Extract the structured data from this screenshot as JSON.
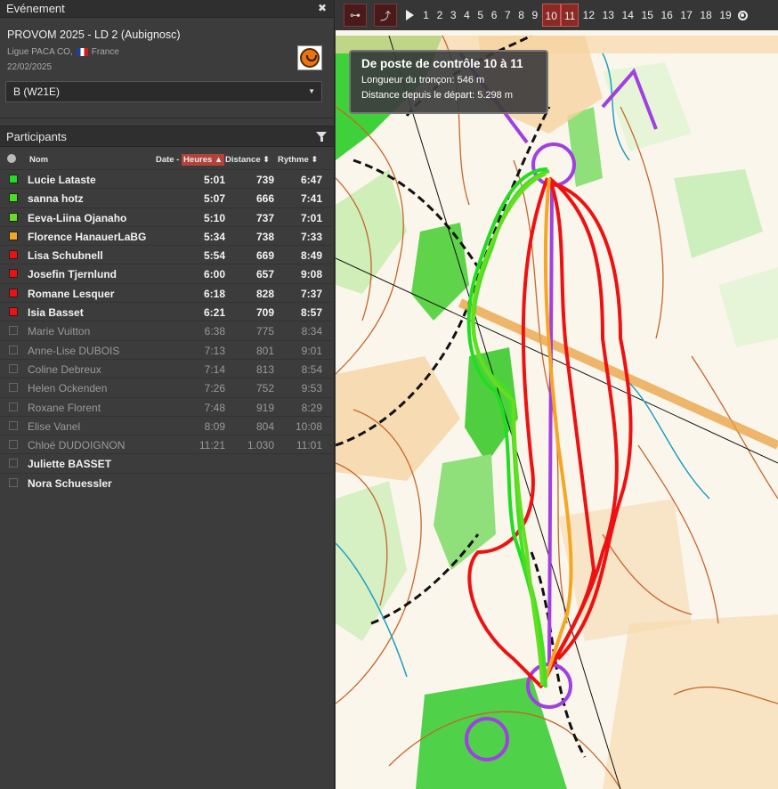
{
  "event": {
    "panel_title": "Evénement",
    "title": "PROVOM 2025 - LD 2 (Aubignosc)",
    "organizer": "Ligue PACA CO,",
    "country": "France",
    "date": "22/02/2025",
    "category": "B (W21E)"
  },
  "participants": {
    "panel_title": "Participants",
    "columns": {
      "name": "Nom",
      "time_prefix": "Date - ",
      "time": "Heures",
      "distance": "Distance",
      "pace": "Rythme"
    },
    "rows": [
      {
        "name": "Lucie Lataste",
        "time": "5:01",
        "distance": "739",
        "pace": "6:47",
        "color": "#22dd22",
        "active": true
      },
      {
        "name": "sanna hotz",
        "time": "5:07",
        "distance": "666",
        "pace": "7:41",
        "color": "#44e022",
        "active": true
      },
      {
        "name": "Eeva-Liina Ojanaho",
        "time": "5:10",
        "distance": "737",
        "pace": "7:01",
        "color": "#66dd22",
        "active": true
      },
      {
        "name": "Florence HanauerLaBG",
        "time": "5:34",
        "distance": "738",
        "pace": "7:33",
        "color": "#f5a623",
        "active": true
      },
      {
        "name": "Lisa Schubnell",
        "time": "5:54",
        "distance": "669",
        "pace": "8:49",
        "color": "#ee1111",
        "active": true
      },
      {
        "name": "Josefin Tjernlund",
        "time": "6:00",
        "distance": "657",
        "pace": "9:08",
        "color": "#ee1111",
        "active": true
      },
      {
        "name": "Romane Lesquer",
        "time": "6:18",
        "distance": "828",
        "pace": "7:37",
        "color": "#ee1111",
        "active": true
      },
      {
        "name": "Isia Basset",
        "time": "6:21",
        "distance": "709",
        "pace": "8:57",
        "color": "#ee1111",
        "active": true
      },
      {
        "name": "Marie Vuitton",
        "time": "6:38",
        "distance": "775",
        "pace": "8:34",
        "color": "",
        "active": false
      },
      {
        "name": "Anne-Lise DUBOIS",
        "time": "7:13",
        "distance": "801",
        "pace": "9:01",
        "color": "",
        "active": false
      },
      {
        "name": "Coline Debreux",
        "time": "7:14",
        "distance": "813",
        "pace": "8:54",
        "color": "",
        "active": false
      },
      {
        "name": "Helen Ockenden",
        "time": "7:26",
        "distance": "752",
        "pace": "9:53",
        "color": "",
        "active": false
      },
      {
        "name": "Roxane Florent",
        "time": "7:48",
        "distance": "919",
        "pace": "8:29",
        "color": "",
        "active": false
      },
      {
        "name": "Elise Vanel",
        "time": "8:09",
        "distance": "804",
        "pace": "10:08",
        "color": "",
        "active": false
      },
      {
        "name": "Chloé DUDOIGNON",
        "time": "11:21",
        "distance": "1.030",
        "pace": "11:01",
        "color": "",
        "active": false
      },
      {
        "name": "Juliette BASSET",
        "time": "",
        "distance": "",
        "pace": "",
        "color": "",
        "active": true
      },
      {
        "name": "Nora Schuessler",
        "time": "",
        "distance": "",
        "pace": "",
        "color": "",
        "active": true
      }
    ]
  },
  "toolbar": {
    "legs": [
      "1",
      "2",
      "3",
      "4",
      "5",
      "6",
      "7",
      "8",
      "9",
      "10",
      "11",
      "12",
      "13",
      "14",
      "15",
      "16",
      "17",
      "18",
      "19"
    ],
    "active_legs": [
      "10",
      "11"
    ],
    "icons": [
      "leg-split-icon",
      "route-icon",
      "play-icon",
      "finish-icon"
    ]
  },
  "leg_info": {
    "title": "De poste de contrôle 10 à 11",
    "length": "Longueur du tronçon: 546 m",
    "distance": "Distance depuis le départ: 5.298 m"
  },
  "colors": {
    "accent": "#b3433a",
    "course": "#a040e0"
  }
}
